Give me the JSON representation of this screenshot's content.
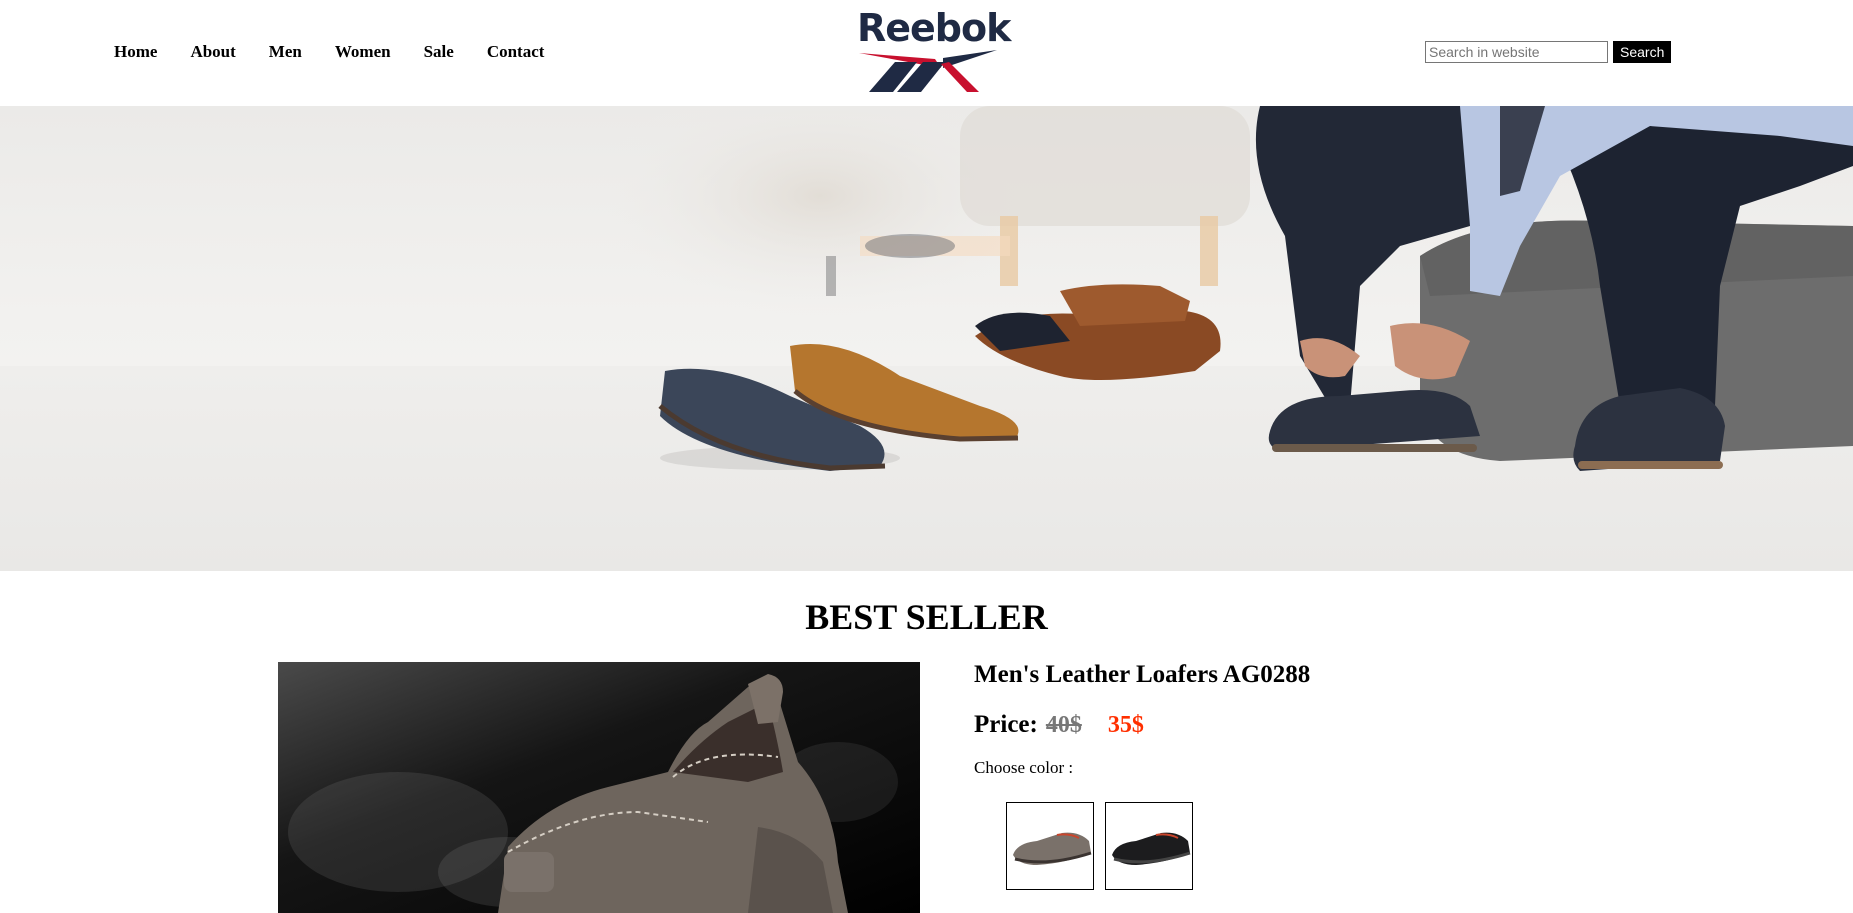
{
  "nav": {
    "items": [
      {
        "label": "Home"
      },
      {
        "label": "About"
      },
      {
        "label": "Men"
      },
      {
        "label": "Women"
      },
      {
        "label": "Sale"
      },
      {
        "label": "Contact"
      }
    ]
  },
  "logo": {
    "text": "Reebok"
  },
  "search": {
    "placeholder": "Search in website",
    "value": "",
    "button_label": "Search"
  },
  "hero": {
    "icon": "hero-banner-image"
  },
  "best_seller": {
    "title": "BEST SELLER",
    "product": {
      "name": "Men's Leather Loafers AG0288",
      "price_label": "Price:",
      "old_price": "40$",
      "new_price": "35$",
      "choose_color_label": "Choose color :",
      "colors": [
        {
          "name": "grey",
          "hex": "#7a716a"
        },
        {
          "name": "black",
          "hex": "#1c1c1e"
        }
      ]
    }
  },
  "colors": {
    "brand_navy": "#1f2a44",
    "brand_red": "#c8102e",
    "sale_red": "#ff2f00"
  }
}
